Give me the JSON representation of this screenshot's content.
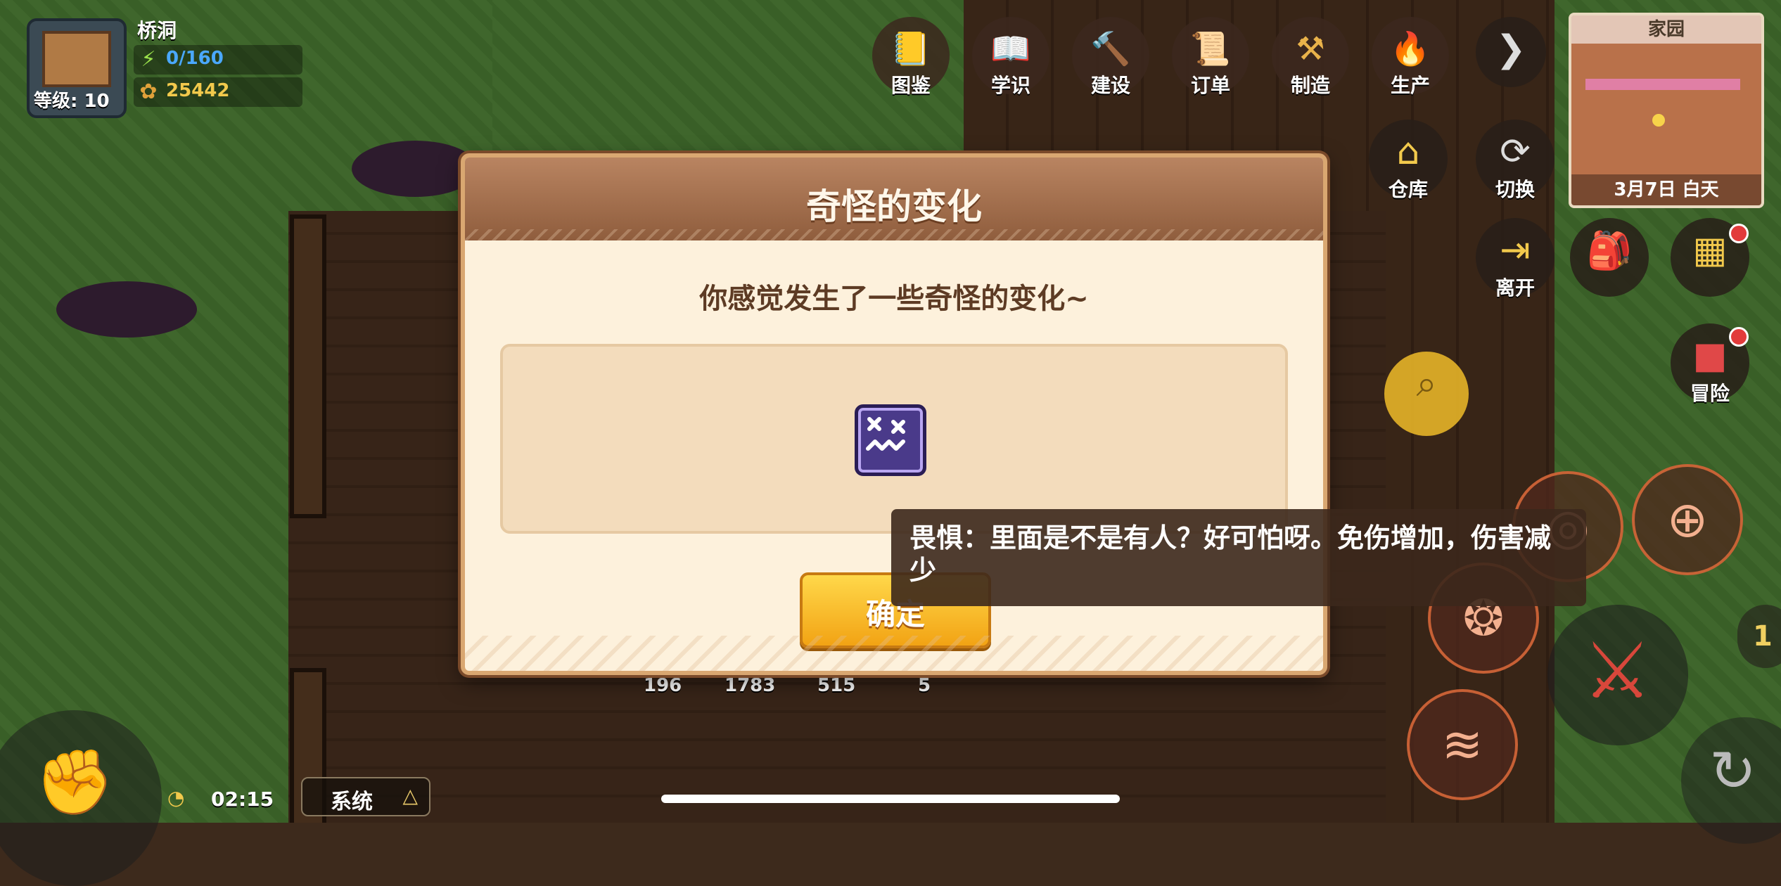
{
  "hud": {
    "location": "桥洞",
    "level_label": "等级: 10",
    "energy": "0/160",
    "coins": "25442"
  },
  "top_buttons": [
    {
      "label": "图鉴",
      "icon": "book-icon"
    },
    {
      "label": "学识",
      "icon": "open-book-icon"
    },
    {
      "label": "建设",
      "icon": "hammer-icon"
    },
    {
      "label": "订单",
      "icon": "scroll-icon"
    },
    {
      "label": "制造",
      "icon": "tools-icon"
    },
    {
      "label": "生产",
      "icon": "flame-icon"
    }
  ],
  "right_buttons": {
    "storage": "仓库",
    "switch": "切换",
    "leave": "离开",
    "adventure": "冒险"
  },
  "minimap": {
    "title": "家园",
    "date": "3月7日 白天"
  },
  "bottom": {
    "clock": "02:15",
    "system_label": "系统",
    "counts": [
      "196",
      "1783",
      "515",
      "5"
    ],
    "side_number": "1"
  },
  "dialog": {
    "title": "奇怪的变化",
    "message": "你感觉发生了一些奇怪的变化~",
    "confirm_label": "确定",
    "status_icon": "dizzy-face-icon"
  },
  "tooltip": {
    "text": "畏惧：里面是不是有人？好可怕呀。免伤增加，伤害减少"
  },
  "colors": {
    "dialog_bg": "#fdf1dc",
    "dialog_header": "#a06c4a",
    "confirm_button": "#f7c02a",
    "status_icon_bg": "#4a3a8a"
  }
}
